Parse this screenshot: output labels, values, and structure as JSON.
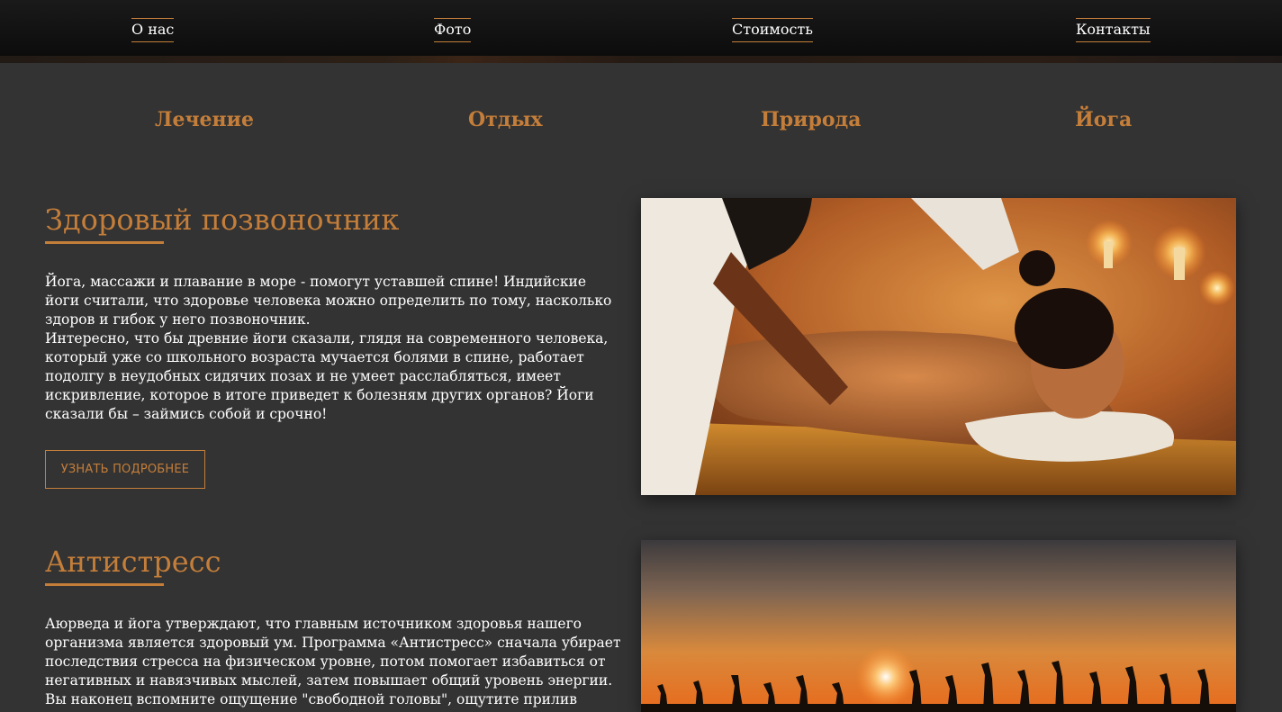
{
  "nav": {
    "items": [
      "О нас",
      "Фото",
      "Стоимость",
      "Контакты"
    ]
  },
  "categories": [
    "Лечение",
    "Отдых",
    "Природа",
    "Йога"
  ],
  "sections": [
    {
      "title": "Здоровый позвоночник",
      "paragraphs": [
        "Йога, массажи и плавание в море - помогут уставшей спине! Индийские йоги считали, что здоровье человека можно определить по тому, насколько здоров и гибок у него позвоночник.",
        "Интересно, что бы древние йоги сказали, глядя на современного человека, который уже со школьного возраста мучается болями в спине, работает подолгу в неудобных сидячих позах и не умеет расслабляться, имеет искривление, которое в итоге приведет к болезням других органов? Йоги сказали бы – займись собой и срочно!"
      ],
      "button": "УЗНАТЬ ПОДРОБНЕЕ",
      "image": "massage-photo"
    },
    {
      "title": "Антистресс",
      "paragraphs": [
        "Аюрведа и йога утверждают, что главным источником здоровья нашего организма является здоровый ум. Программа «Антистресс» сначала убирает последствия стресса на физическом уровне, потом помогает избавиться от негативных и навязчивых мыслей, затем повышает общий уровень энергии. Вы наконец вспомните ощущение \"свободной головы\", ощутите прилив"
      ],
      "image": "sunset-crowd-photo"
    }
  ],
  "colors": {
    "accent": "#c47e3a",
    "background": "#333333",
    "nav_background": "#111111"
  }
}
